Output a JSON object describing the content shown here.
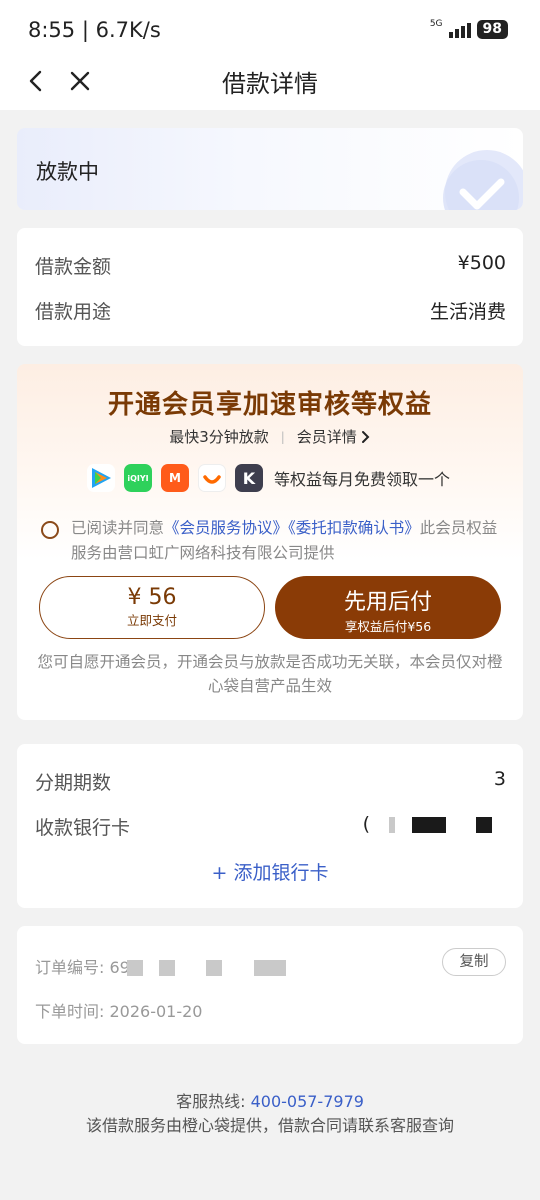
{
  "status_bar": {
    "time": "8:55 | 6.7K/s",
    "network": "5G",
    "battery": "98"
  },
  "nav": {
    "title": "借款详情"
  },
  "loan_status": {
    "text": "放款中"
  },
  "loan_info": {
    "amount_label": "借款金额",
    "amount_value": "¥500",
    "purpose_label": "借款用途",
    "purpose_value": "生活消费"
  },
  "membership": {
    "title": "开通会员享加速审核等权益",
    "fast_text": "最快3分钟放款",
    "separator": "|",
    "details_link": "会员详情",
    "app_icons": [
      "tencent-video-icon",
      "iqiyi-icon",
      "mango-tv-icon",
      "didi-icon",
      "kuaikan-icon"
    ],
    "apps_text": "等权益每月免费领取一个",
    "agree_prefix": "已阅读并同意",
    "agree_link1": "《会员服务协议》",
    "agree_link2": "《委托扣款确认书》",
    "agree_suffix": "此会员权益服务由营口虹广网络科技有限公司提供",
    "pay_now_amount": "¥ 56",
    "pay_now_label": "立即支付",
    "pay_later_title": "先用后付",
    "pay_later_sub": "享权益后付¥56",
    "note": "您可自愿开通会员，开通会员与放款是否成功无关联，本会员仅对橙心袋自营产品生效"
  },
  "bank": {
    "installments_label": "分期期数",
    "installments_value": "3",
    "card_label": "收款银行卡",
    "card_value": "(",
    "add_card": "添加银行卡"
  },
  "order": {
    "number_label": "订单编号:",
    "number_visible": "69",
    "copy_label": "复制",
    "time_label": "下单时间:",
    "time_value": "2026-01-20"
  },
  "footer": {
    "hotline_label": "客服热线:",
    "hotline_number": "400-057-7979",
    "notice": "该借款服务由橙心袋提供，借款合同请联系客服查询"
  },
  "colors": {
    "accent_brown": "#8a3b06",
    "link_blue": "#3a5fc8",
    "page_bg": "#f2f2f2"
  }
}
